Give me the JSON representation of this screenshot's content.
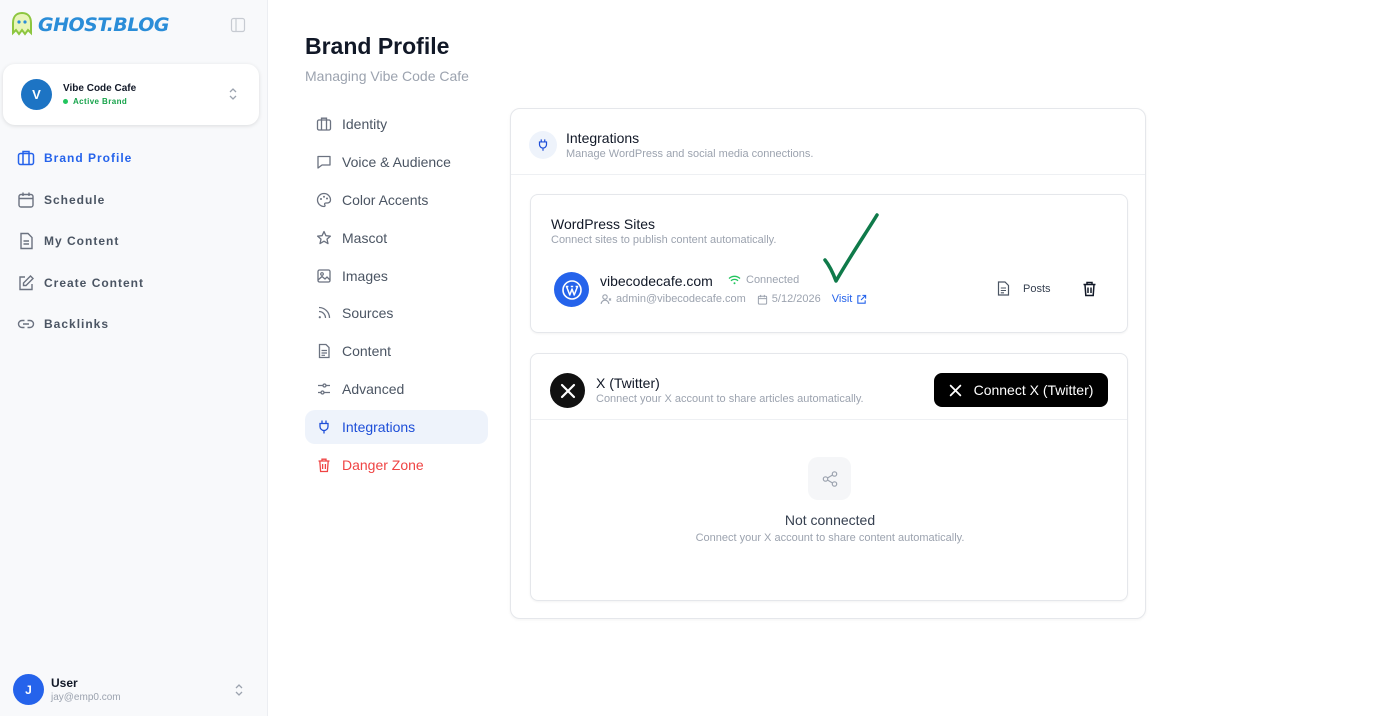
{
  "app": {
    "logo_text": "GHOST.BLOG"
  },
  "brand": {
    "initial": "V",
    "name": "Vibe Code Cafe",
    "status": "Active Brand"
  },
  "sidebar": {
    "items": [
      {
        "label": "Brand Profile",
        "icon": "briefcase-icon",
        "active": true
      },
      {
        "label": "Schedule",
        "icon": "calendar-icon"
      },
      {
        "label": "My Content",
        "icon": "document-icon"
      },
      {
        "label": "Create Content",
        "icon": "edit-icon"
      },
      {
        "label": "Backlinks",
        "icon": "link-icon"
      }
    ]
  },
  "user": {
    "initial": "J",
    "name": "User",
    "email": "jay@emp0.com"
  },
  "page": {
    "title": "Brand Profile",
    "subtitle": "Managing Vibe Code Cafe"
  },
  "subnav": {
    "items": [
      {
        "label": "Identity",
        "icon": "briefcase-icon"
      },
      {
        "label": "Voice & Audience",
        "icon": "message-square-icon"
      },
      {
        "label": "Color Accents",
        "icon": "palette-icon"
      },
      {
        "label": "Mascot",
        "icon": "star-icon"
      },
      {
        "label": "Images",
        "icon": "image-icon"
      },
      {
        "label": "Sources",
        "icon": "rss-icon"
      },
      {
        "label": "Content",
        "icon": "file-text-icon"
      },
      {
        "label": "Advanced",
        "icon": "sliders-icon"
      },
      {
        "label": "Integrations",
        "icon": "plug-icon",
        "active": true
      },
      {
        "label": "Danger Zone",
        "icon": "trash-icon",
        "danger": true
      }
    ]
  },
  "integrations": {
    "title": "Integrations",
    "description": "Manage WordPress and social media connections.",
    "wordpress": {
      "title": "WordPress Sites",
      "description": "Connect sites to publish content automatically.",
      "site": {
        "name": "vibecodecafe.com",
        "status": "Connected",
        "admin": "admin@vibecodecafe.com",
        "date": "5/12/2026",
        "visit_label": "Visit"
      },
      "posts_label": "Posts"
    },
    "x": {
      "title": "X (Twitter)",
      "description": "Connect your X account to share articles automatically.",
      "connect_label": "Connect X (Twitter)",
      "empty_title": "Not connected",
      "empty_description": "Connect your X account to share content automatically."
    }
  },
  "colors": {
    "accent": "#2563eb",
    "logo": "#2a8dd8",
    "success": "#22c55e",
    "danger": "#ef4444",
    "checkmark": "#0f7a4a"
  }
}
